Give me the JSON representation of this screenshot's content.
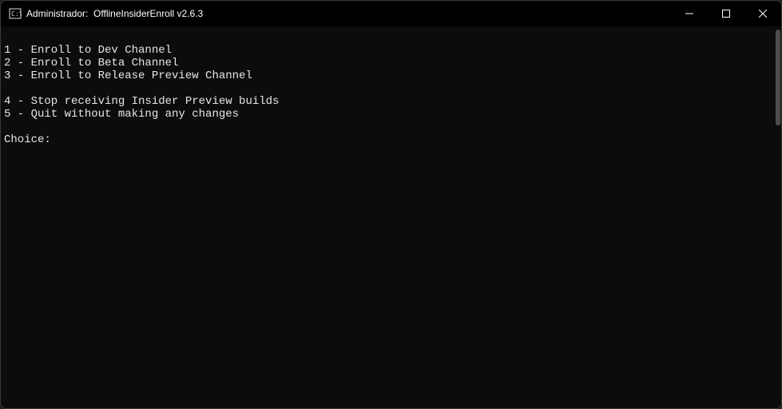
{
  "titlebar": {
    "text": "Administrador:  OfflineInsiderEnroll v2.6.3"
  },
  "console": {
    "lines": [
      "",
      "1 - Enroll to Dev Channel",
      "2 - Enroll to Beta Channel",
      "3 - Enroll to Release Preview Channel",
      "",
      "4 - Stop receiving Insider Preview builds",
      "5 - Quit without making any changes",
      "",
      "Choice:"
    ]
  }
}
